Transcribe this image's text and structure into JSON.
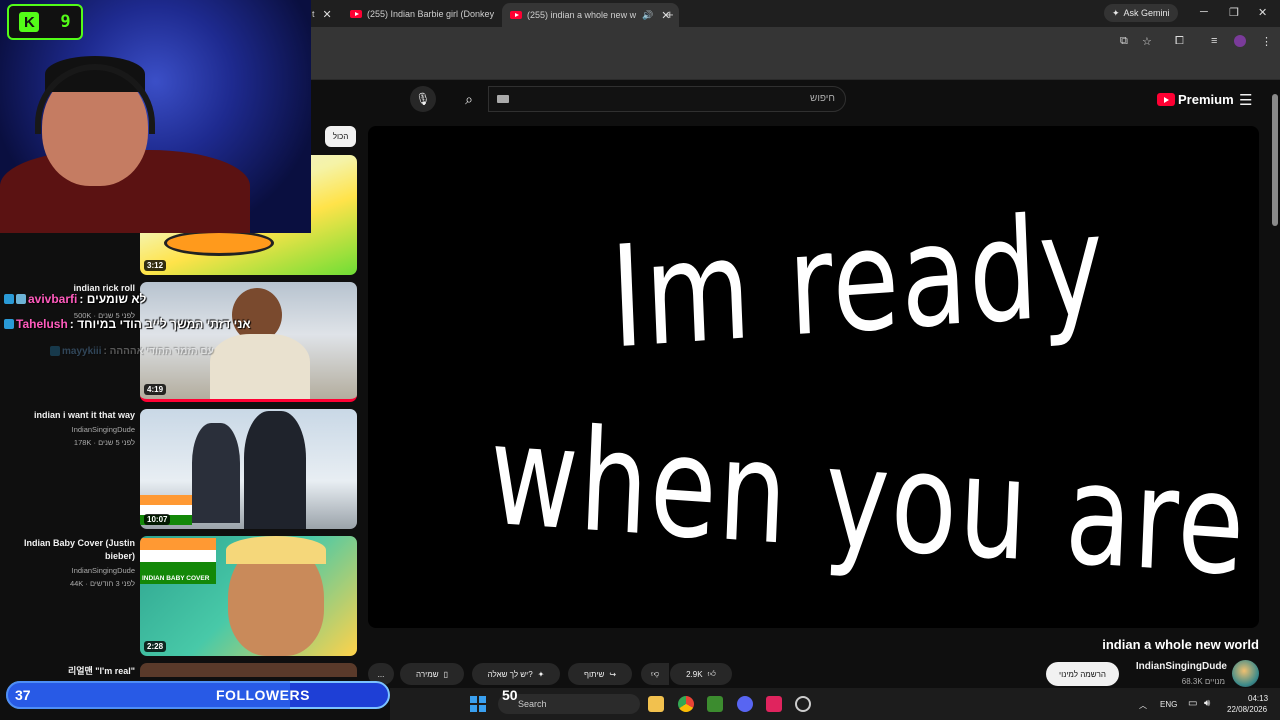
{
  "browser": {
    "tabs": [
      {
        "label": "(255) Indian Barbie girl (Donkey"
      },
      {
        "label": "(255) indian a whole new w"
      }
    ],
    "ask_gemini": "Ask Gemini"
  },
  "youtube": {
    "search_placeholder": "חיפוש",
    "premium_label": "Premium",
    "chip_all": "הכול"
  },
  "video": {
    "lyric_line1": "Im ready",
    "lyric_line2": "when you are",
    "title": "indian a whole new world",
    "channel": "IndianSingingDude",
    "subscribers": "68.3K מנויים",
    "subscribe_label": "הרשמה למינוי",
    "likes": "2.9K",
    "share_label": "שיתוף",
    "ask_label": "יש לך שאלה?",
    "save_label": "שמירה",
    "more_label": "..."
  },
  "recommendations": [
    {
      "title": "",
      "channel": "",
      "meta": "",
      "duration": "3:12"
    },
    {
      "title": "indian rick roll",
      "channel": "",
      "meta": "500K · לפני 5 שנים",
      "duration": "4:19"
    },
    {
      "title": "indian i want it that way",
      "channel": "IndianSingingDude",
      "meta": "178K · לפני 5 שנים",
      "duration": "10:07"
    },
    {
      "title": "Indian Baby Cover (Justin bieber)",
      "channel": "IndianSingingDude",
      "meta": "44K · לפני 3 חודשים",
      "duration": "2:28",
      "badge": "INDIAN BABY COVER"
    },
    {
      "title": "리얼맨 \"I'm real\"",
      "channel": "",
      "meta": "",
      "duration": ""
    }
  ],
  "stream": {
    "kick_count": "9",
    "chat": [
      {
        "user": "avivbarfi",
        "message": "לא שומעים :",
        "color": "#ff5bbd"
      },
      {
        "user": "Tahelush",
        "message": "אני דזתי המשך לייב הודי במיוחד :",
        "color": "#ff5bbd"
      },
      {
        "user": "mayykiii",
        "message": "עם הזמר ההודי אהההה :",
        "color": "#7cc2ff"
      }
    ],
    "followers_count": "37",
    "followers_label": "FOLLOWERS",
    "followers_goal": "50",
    "followers_progress": 0.74
  },
  "taskbar": {
    "search_label": "Search",
    "language": "ENG",
    "time": "04:13",
    "date": "22/08/2026"
  }
}
